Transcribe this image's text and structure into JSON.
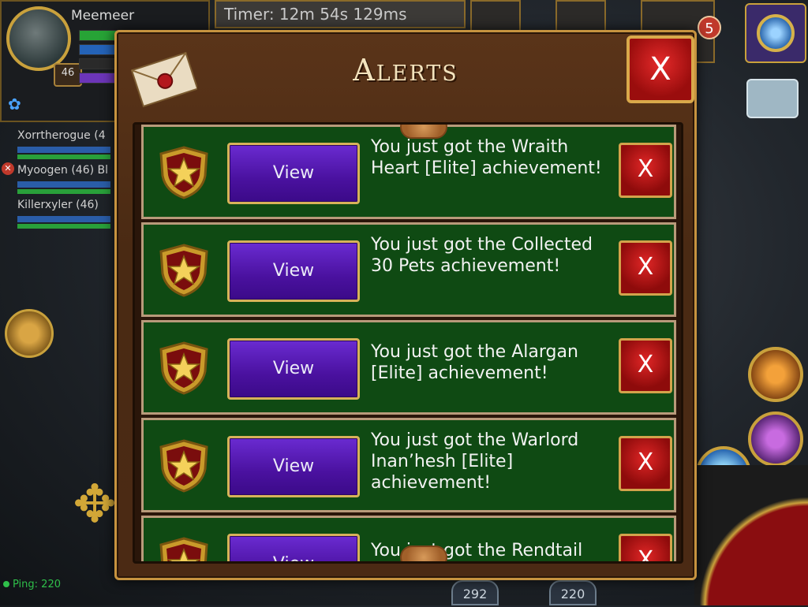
{
  "hud": {
    "player_name": "Meemeer",
    "player_level": "46",
    "timer": "Timer: 12m 54s 129ms",
    "notification_count": "5",
    "party": [
      {
        "name": "Xorrtherogue (4"
      },
      {
        "name": "Myoogen (46) Bl"
      },
      {
        "name": "Killerxyler (46)"
      }
    ],
    "ping": "Ping: 220",
    "bottom_counts": [
      "292",
      "220"
    ]
  },
  "dialog": {
    "title": "Alerts",
    "close_label": "X",
    "alerts": [
      {
        "view_label": "View",
        "text": "You just got the Wraith Heart [Elite] achievement!",
        "close_label": "X"
      },
      {
        "view_label": "View",
        "text": "You just got the Collected 30 Pets achievement!",
        "close_label": "X"
      },
      {
        "view_label": "View",
        "text": "You just got the Alargan [Elite] achievement!",
        "close_label": "X"
      },
      {
        "view_label": "View",
        "text": "You just got the Warlord Inan’hesh [Elite] achievement!",
        "close_label": "X"
      },
      {
        "view_label": "View",
        "text": "You just got the Rendtail",
        "close_label": "X"
      }
    ]
  },
  "colors": {
    "row_green": "#0f4a13",
    "view_purple": "#4a119f",
    "close_red": "#c01818",
    "gold_border": "#c7933f"
  }
}
